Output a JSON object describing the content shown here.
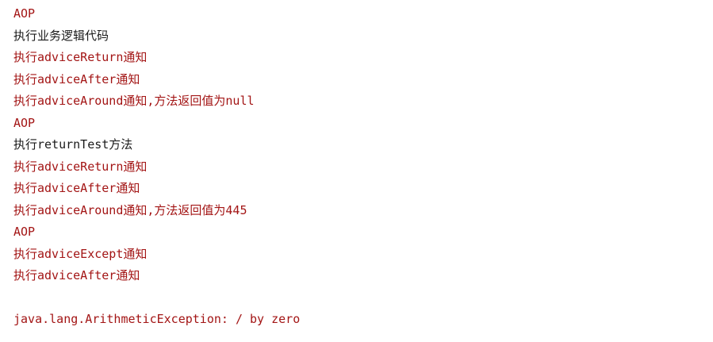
{
  "console": {
    "lines": [
      {
        "text": "AOP",
        "kind": "err"
      },
      {
        "text": "执行业务逻辑代码",
        "kind": "out"
      },
      {
        "text": "执行adviceReturn通知",
        "kind": "err"
      },
      {
        "text": "执行adviceAfter通知",
        "kind": "err"
      },
      {
        "text": "执行adviceAround通知,方法返回值为null",
        "kind": "err"
      },
      {
        "text": "AOP",
        "kind": "err"
      },
      {
        "text": "执行returnTest方法",
        "kind": "out"
      },
      {
        "text": "执行adviceReturn通知",
        "kind": "err"
      },
      {
        "text": "执行adviceAfter通知",
        "kind": "err"
      },
      {
        "text": "执行adviceAround通知,方法返回值为445",
        "kind": "err"
      },
      {
        "text": "AOP",
        "kind": "err"
      },
      {
        "text": "执行adviceExcept通知",
        "kind": "err"
      },
      {
        "text": "执行adviceAfter通知",
        "kind": "err"
      },
      {
        "text": "",
        "kind": "blank"
      },
      {
        "text": "java.lang.ArithmeticException: / by zero",
        "kind": "err"
      }
    ]
  },
  "colors": {
    "stderr": "#a31515",
    "stdout": "#1a1a1a",
    "background": "#ffffff"
  }
}
